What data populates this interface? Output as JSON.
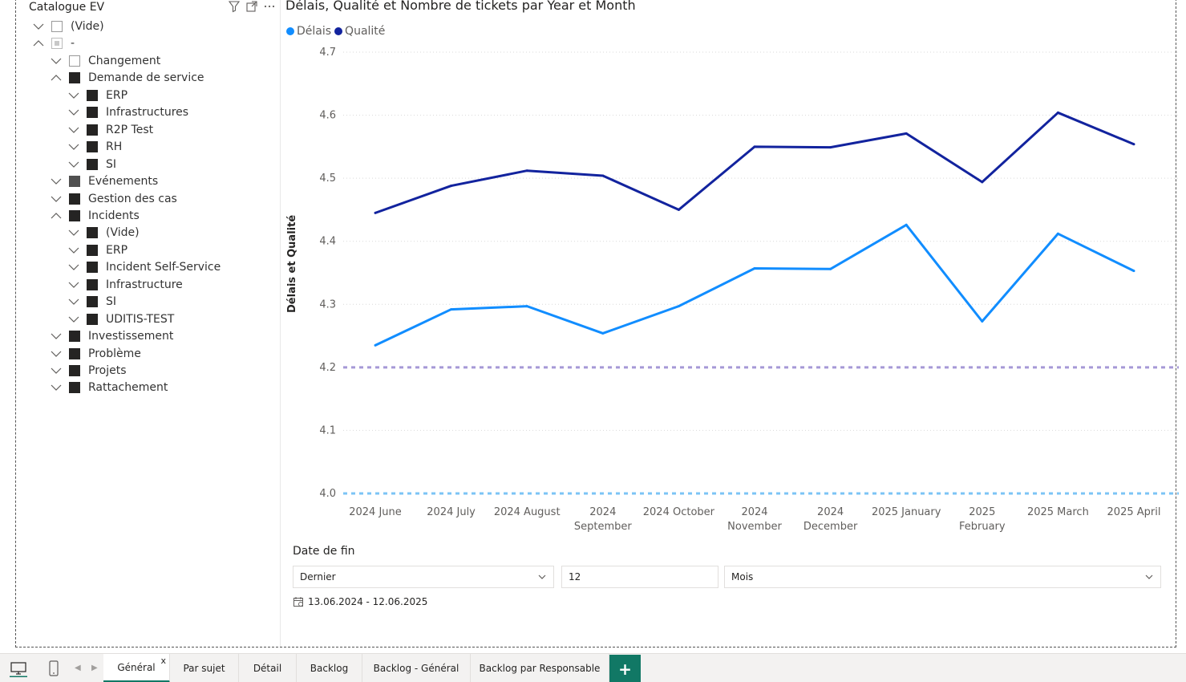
{
  "slicer": {
    "title": "Catalogue EV",
    "items": [
      {
        "label": "(Vide)",
        "level": 0,
        "state": "empty",
        "expand": "down"
      },
      {
        "label": "-",
        "level": 0,
        "state": "partial",
        "expand": "up"
      },
      {
        "label": "Changement",
        "level": 1,
        "state": "empty",
        "expand": "down"
      },
      {
        "label": "Demande de service",
        "level": 1,
        "state": "full",
        "expand": "up"
      },
      {
        "label": "ERP",
        "level": 2,
        "state": "full",
        "expand": "down"
      },
      {
        "label": "Infrastructures",
        "level": 2,
        "state": "full",
        "expand": "down"
      },
      {
        "label": "R2P Test",
        "level": 2,
        "state": "full",
        "expand": "down"
      },
      {
        "label": "RH",
        "level": 2,
        "state": "full",
        "expand": "down"
      },
      {
        "label": "SI",
        "level": 2,
        "state": "full",
        "expand": "down"
      },
      {
        "label": "Evénements",
        "level": 1,
        "state": "dim",
        "expand": "down"
      },
      {
        "label": "Gestion des cas",
        "level": 1,
        "state": "full",
        "expand": "down"
      },
      {
        "label": "Incidents",
        "level": 1,
        "state": "full",
        "expand": "up"
      },
      {
        "label": "(Vide)",
        "level": 2,
        "state": "full",
        "expand": "down"
      },
      {
        "label": "ERP",
        "level": 2,
        "state": "full",
        "expand": "down"
      },
      {
        "label": "Incident Self-Service",
        "level": 2,
        "state": "full",
        "expand": "down"
      },
      {
        "label": "Infrastructure",
        "level": 2,
        "state": "full",
        "expand": "down"
      },
      {
        "label": "SI",
        "level": 2,
        "state": "full",
        "expand": "down"
      },
      {
        "label": "UDITIS-TEST",
        "level": 2,
        "state": "full",
        "expand": "down"
      },
      {
        "label": "Investissement",
        "level": 1,
        "state": "full",
        "expand": "down"
      },
      {
        "label": "Problème",
        "level": 1,
        "state": "full",
        "expand": "down"
      },
      {
        "label": "Projets",
        "level": 1,
        "state": "full",
        "expand": "down"
      },
      {
        "label": "Rattachement",
        "level": 1,
        "state": "full",
        "expand": "down"
      }
    ]
  },
  "chart_data": {
    "type": "line",
    "title": "Délais, Qualité et Nombre de tickets par Year et Month",
    "ylabel": "Délais et Qualité",
    "xlabel": "",
    "ylim": [
      4.0,
      4.7
    ],
    "yticks": [
      "4.7",
      "4.6",
      "4.5",
      "4.4",
      "4.3",
      "4.2",
      "4.1",
      "4.0"
    ],
    "grid": true,
    "legend_position": "top-left",
    "categories": [
      [
        "2024 June"
      ],
      [
        "2024 July"
      ],
      [
        "2024 August"
      ],
      [
        "2024",
        "September"
      ],
      [
        "2024 October"
      ],
      [
        "2024",
        "November"
      ],
      [
        "2024",
        "December"
      ],
      [
        "2025 January"
      ],
      [
        "2025",
        "February"
      ],
      [
        "2025 March"
      ],
      [
        "2025 April"
      ]
    ],
    "series": [
      {
        "name": "Délais",
        "color": "#118dff",
        "values": [
          4.235,
          4.292,
          4.297,
          4.254,
          4.297,
          4.357,
          4.356,
          4.426,
          4.273,
          4.412,
          4.353
        ]
      },
      {
        "name": "Qualité",
        "color": "#12239e",
        "values": [
          4.445,
          4.488,
          4.512,
          4.504,
          4.45,
          4.55,
          4.549,
          4.571,
          4.494,
          4.604,
          4.554
        ]
      }
    ],
    "reference_lines": [
      {
        "value": 4.2,
        "color": "#a699d6",
        "style": "dashed"
      },
      {
        "value": 4.0,
        "color": "#7cc4f5",
        "style": "dashed"
      }
    ]
  },
  "date_filter": {
    "label": "Date de fin",
    "mode": "Dernier",
    "count": "12",
    "unit": "Mois",
    "range": "13.06.2024 - 12.06.2025"
  },
  "tabs": [
    {
      "label": "Général",
      "active": true
    },
    {
      "label": "Par sujet",
      "active": false
    },
    {
      "label": "Détail",
      "active": false
    },
    {
      "label": "Backlog",
      "active": false
    },
    {
      "label": "Backlog - Général",
      "active": false
    },
    {
      "label": "Backlog par Responsable",
      "active": false
    }
  ],
  "tab_close": "x",
  "add_tab": "+",
  "icons": {
    "filter": "filter-icon",
    "focus": "focus-mode-icon",
    "more": "more-options-icon",
    "desktop": "desktop-layout-icon",
    "mobile": "mobile-layout-icon",
    "calendar": "calendar-icon"
  }
}
